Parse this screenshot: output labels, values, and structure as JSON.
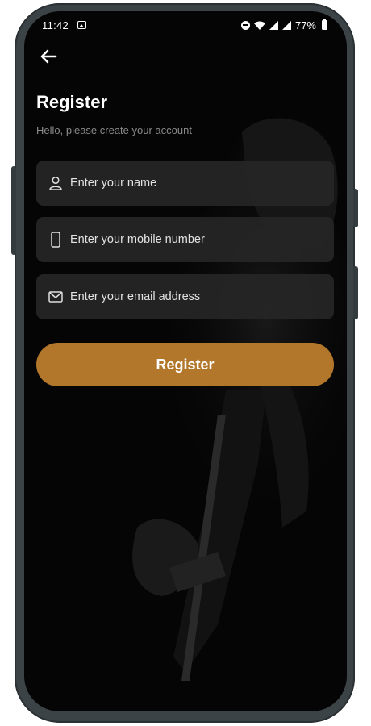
{
  "status_bar": {
    "time": "11:42",
    "battery": "77%",
    "icons": [
      "image-icon",
      "dnd-icon",
      "wifi-icon",
      "signal-icon",
      "signal-icon",
      "battery-icon"
    ]
  },
  "header": {
    "back_icon": "arrow-left-icon"
  },
  "page": {
    "title": "Register",
    "subtitle": "Hello, please create your account"
  },
  "form": {
    "name": {
      "value": "",
      "placeholder": "Enter your name",
      "icon": "user-icon"
    },
    "mobile": {
      "value": "",
      "placeholder": "Enter your mobile number",
      "icon": "phone-icon"
    },
    "email": {
      "value": "",
      "placeholder": "Enter your email address",
      "icon": "mail-icon"
    },
    "submit_label": "Register"
  },
  "colors": {
    "background": "#050505",
    "field_background": "#262626",
    "accent": "#b3772c",
    "text": "#ffffff",
    "muted_text": "#8a8a8a"
  }
}
